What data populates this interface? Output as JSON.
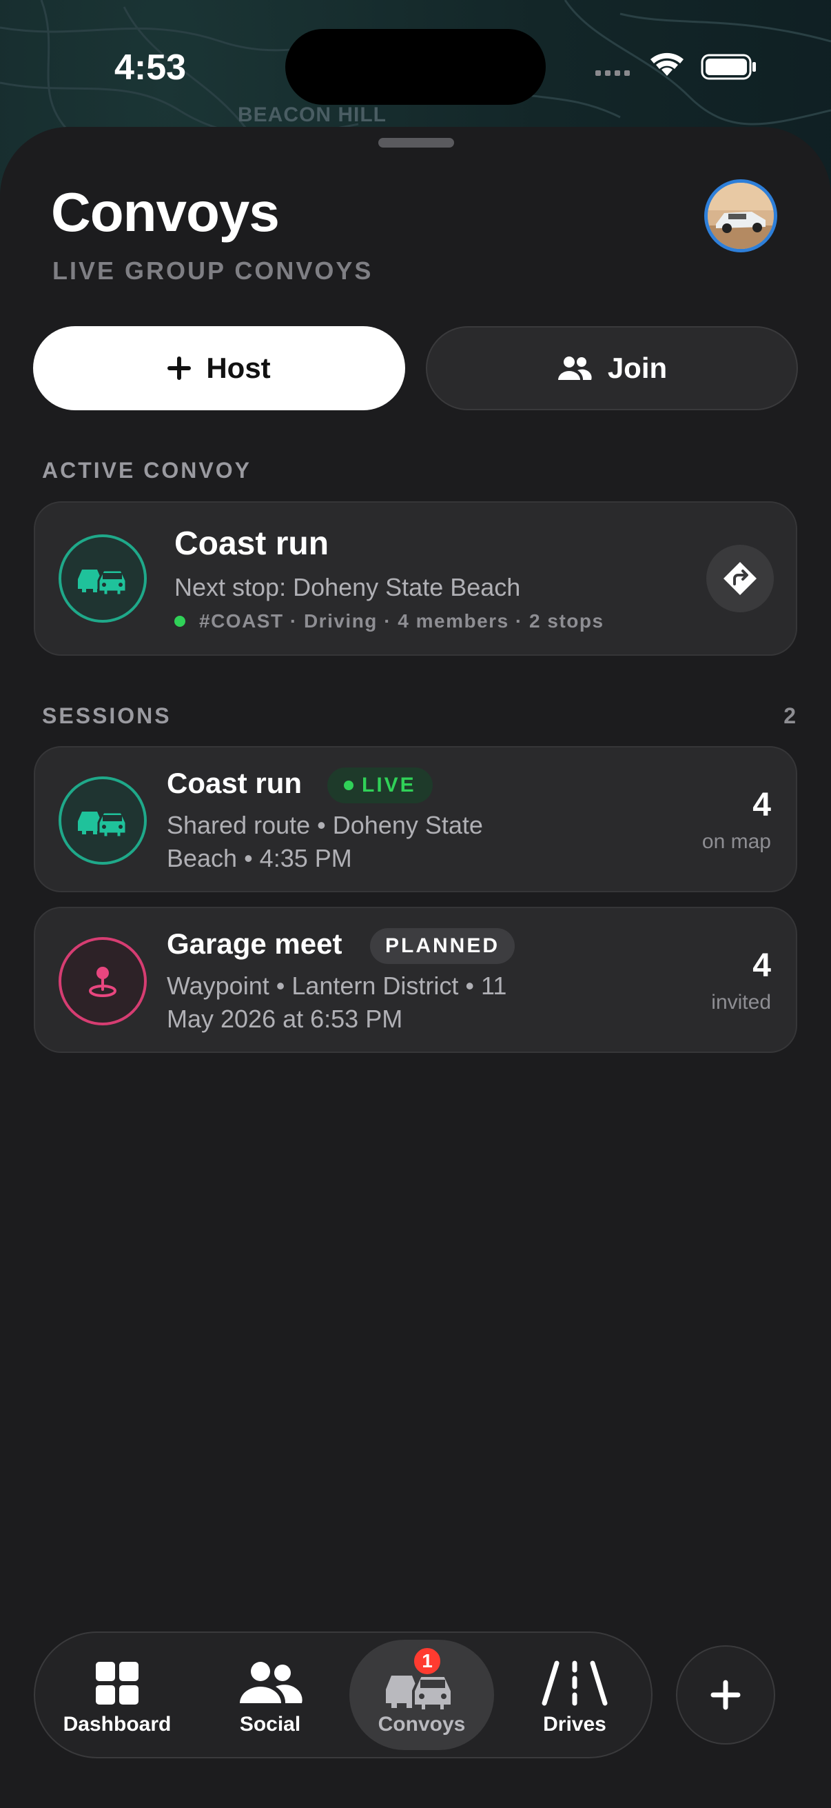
{
  "status_bar": {
    "time": "4:53"
  },
  "map": {
    "label": "BEACON HILL"
  },
  "header": {
    "title": "Convoys",
    "subtitle": "LIVE GROUP CONVOYS"
  },
  "actions": {
    "host_label": "Host",
    "join_label": "Join"
  },
  "active_section": {
    "label": "ACTIVE CONVOY",
    "card": {
      "title": "Coast run",
      "next_stop": "Next stop: Doheny State Beach",
      "meta": "#COAST · Driving · 4 members · 2 stops"
    }
  },
  "sessions_section": {
    "label": "SESSIONS",
    "count": "2",
    "items": [
      {
        "title": "Coast run",
        "badge": "LIVE",
        "line1": "Shared route • Doheny State",
        "line2": "Beach • 4:35 PM",
        "stat_value": "4",
        "stat_label": "on map"
      },
      {
        "title": "Garage meet",
        "badge": "PLANNED",
        "line1": "Waypoint • Lantern District • 11",
        "line2": "May 2026 at 6:53 PM",
        "stat_value": "4",
        "stat_label": "invited"
      }
    ]
  },
  "tabbar": {
    "tabs": [
      {
        "label": "Dashboard",
        "icon": "dashboard-grid-icon"
      },
      {
        "label": "Social",
        "icon": "people-icon"
      },
      {
        "label": "Convoys",
        "icon": "cars-icon",
        "badge": "1",
        "active": true
      },
      {
        "label": "Drives",
        "icon": "road-icon"
      }
    ],
    "fab_icon": "plus-icon"
  },
  "colors": {
    "accent_green": "#1fa98a",
    "accent_pink": "#d63d72",
    "live_green": "#30d158",
    "badge_red": "#ff3b30",
    "avatar_ring": "#2e7fd9"
  }
}
